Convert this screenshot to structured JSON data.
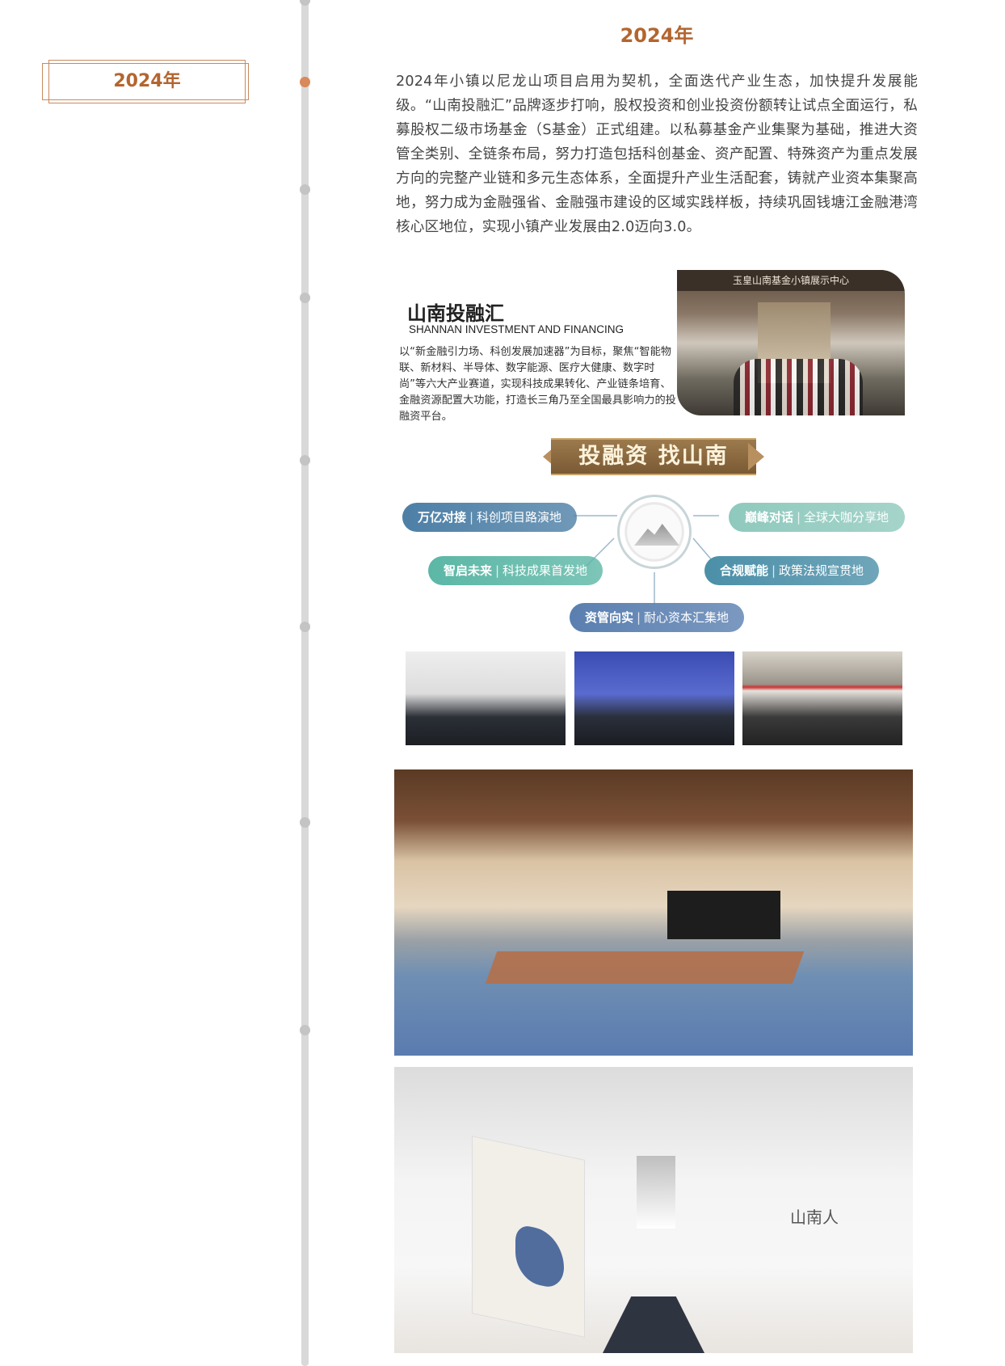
{
  "timeline": {
    "active_year": "2024年"
  },
  "section": {
    "heading": "2024年",
    "intro": "2024年小镇以尼龙山项目启用为契机，全面迭代产业生态，加快提升发展能级。“山南投融汇”品牌逐步打响，股权投资和创业投资份额转让试点全面运行，私募股权二级市场基金（S基金）正式组建。以私募基金产业集聚为基础，推进大资管全类别、全链条布局，努力打造包括科创基金、资产配置、特殊资产为重点发展方向的完整产业链和多元生态体系，全面提升产业生活配套，铸就产业资本集聚高地，努力成为金融强省、金融强市建设的区域实践样板，持续巩固钱塘江金融港湾核心区地位，实现小镇产业发展由2.0迈向3.0。"
  },
  "brand": {
    "title": "山南投融汇",
    "subtitle": "SHANNAN INVESTMENT AND FINANCING",
    "description": "以“新金融引力场、科创发展加速器”为目标，聚焦“智能物联、新材料、半导体、数字能源、医疗大健康、数字时尚”等六大产业赛道，实现科技成果转化、产业链条培育、金融资源配置大功能，打造长三角乃至全国最具影响力的投融资平台。",
    "photo_sign": "玉皇山南基金小镇展示中心"
  },
  "banner": {
    "text": "投融资 找山南"
  },
  "pills": [
    {
      "strong": "万亿对接",
      "rest": "科创项目路演地",
      "color": "#4d7fa6"
    },
    {
      "strong": "巅峰对话",
      "rest": "全球大咖分享地",
      "color": "#8fc9bd"
    },
    {
      "strong": "智启未来",
      "rest": "科技成果首发地",
      "color": "#5cb7a6"
    },
    {
      "strong": "合规赋能",
      "rest": "政策法规宣贯地",
      "color": "#4b8fa8"
    },
    {
      "strong": "资管向实",
      "rest": "耐心资本汇集地",
      "color": "#5a7fb0"
    }
  ],
  "hall_sign": "山南人"
}
